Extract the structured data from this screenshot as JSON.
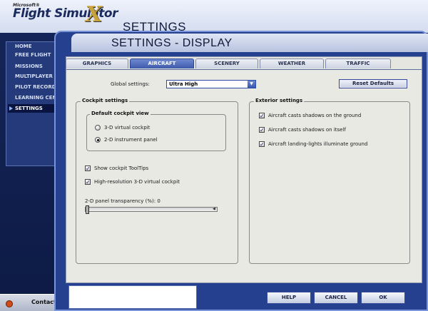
{
  "app": {
    "logo_ms": "Microsoft®",
    "logo_title": "Flight Simulator",
    "logo_x": "X",
    "bg_title": "SETTINGS"
  },
  "left_nav": {
    "items": [
      {
        "label": "HOME"
      },
      {
        "label": "FREE FLIGHT"
      },
      {
        "label": "MISSIONS"
      },
      {
        "label": "MULTIPLAYER"
      },
      {
        "label": "PILOT RECORDS"
      },
      {
        "label": "LEARNING CENTER"
      },
      {
        "label": "SETTINGS",
        "active": true
      }
    ]
  },
  "contacts": {
    "label": "Contacts"
  },
  "dialog": {
    "title": "SETTINGS - DISPLAY",
    "tabs": [
      "GRAPHICS",
      "AIRCRAFT",
      "SCENERY",
      "WEATHER",
      "TRAFFIC"
    ],
    "active_tab": "AIRCRAFT",
    "global_settings_label": "Global settings:",
    "global_settings_value": "Ultra High",
    "reset_defaults": "Reset Defaults",
    "cockpit": {
      "title": "Cockpit settings",
      "view_title": "Default cockpit view",
      "radio_3d": "3-D virtual cockpit",
      "radio_2d": "2-D instrument panel",
      "radio_3d_selected": false,
      "radio_2d_selected": true,
      "show_tooltips": "Show cockpit ToolTips",
      "show_tooltips_checked": true,
      "hires_vc": "High-resolution 3-D virtual cockpit",
      "hires_vc_checked": true,
      "panel_transparency_label": "2-D panel transparency (%): 0",
      "panel_transparency_value": 0
    },
    "exterior": {
      "title": "Exterior settings",
      "items": [
        {
          "label": "Aircraft casts shadows on the ground",
          "checked": true
        },
        {
          "label": "Aircraft casts shadows on itself",
          "checked": true
        },
        {
          "label": "Aircraft landing-lights illuminate ground",
          "checked": true
        }
      ]
    },
    "buttons": {
      "help": "HELP",
      "cancel": "CANCEL",
      "ok": "OK"
    }
  },
  "colors": {
    "dialog_blue": "#24408e",
    "panel_bg": "#e9e9e3",
    "active_tab": "#3e5aaa"
  }
}
